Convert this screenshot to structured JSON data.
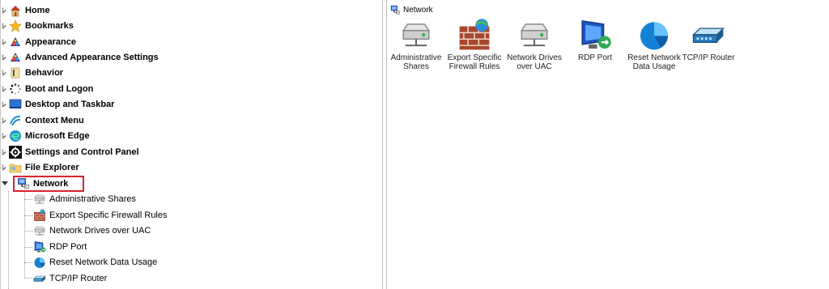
{
  "tree": {
    "items": [
      {
        "label": "Home",
        "icon": "home-icon"
      },
      {
        "label": "Bookmarks",
        "icon": "star-icon"
      },
      {
        "label": "Appearance",
        "icon": "appearance-icon"
      },
      {
        "label": "Advanced Appearance Settings",
        "icon": "advanced-appearance-icon"
      },
      {
        "label": "Behavior",
        "icon": "behavior-icon"
      },
      {
        "label": "Boot and Logon",
        "icon": "boot-spinner-icon"
      },
      {
        "label": "Desktop and Taskbar",
        "icon": "desktop-icon"
      },
      {
        "label": "Context Menu",
        "icon": "context-menu-icon"
      },
      {
        "label": "Microsoft Edge",
        "icon": "edge-icon"
      },
      {
        "label": "Settings and Control Panel",
        "icon": "gear-icon"
      },
      {
        "label": "File Explorer",
        "icon": "file-explorer-icon"
      },
      {
        "label": "Network",
        "icon": "network-icon"
      }
    ],
    "network_children": [
      {
        "label": "Administrative Shares",
        "icon": "network-drive-icon"
      },
      {
        "label": "Export Specific Firewall Rules",
        "icon": "firewall-icon"
      },
      {
        "label": "Network Drives over UAC",
        "icon": "network-drive-icon"
      },
      {
        "label": "RDP Port",
        "icon": "rdp-icon"
      },
      {
        "label": "Reset Network Data Usage",
        "icon": "pie-chart-icon"
      },
      {
        "label": "TCP/IP Router",
        "icon": "router-icon"
      }
    ],
    "selected": "Network"
  },
  "content": {
    "header": "Network",
    "items": [
      {
        "label": "Administrative Shares",
        "icon": "network-drive-icon"
      },
      {
        "label": "Export Specific Firewall Rules",
        "icon": "firewall-icon"
      },
      {
        "label": "Network Drives over UAC",
        "icon": "network-drive-icon"
      },
      {
        "label": "RDP Port",
        "icon": "rdp-icon"
      },
      {
        "label": "Reset Network Data Usage",
        "icon": "pie-chart-icon"
      },
      {
        "label": "TCP/IP Router",
        "icon": "router-icon"
      }
    ]
  },
  "colors": {
    "selection_outline": "#d9232b"
  }
}
